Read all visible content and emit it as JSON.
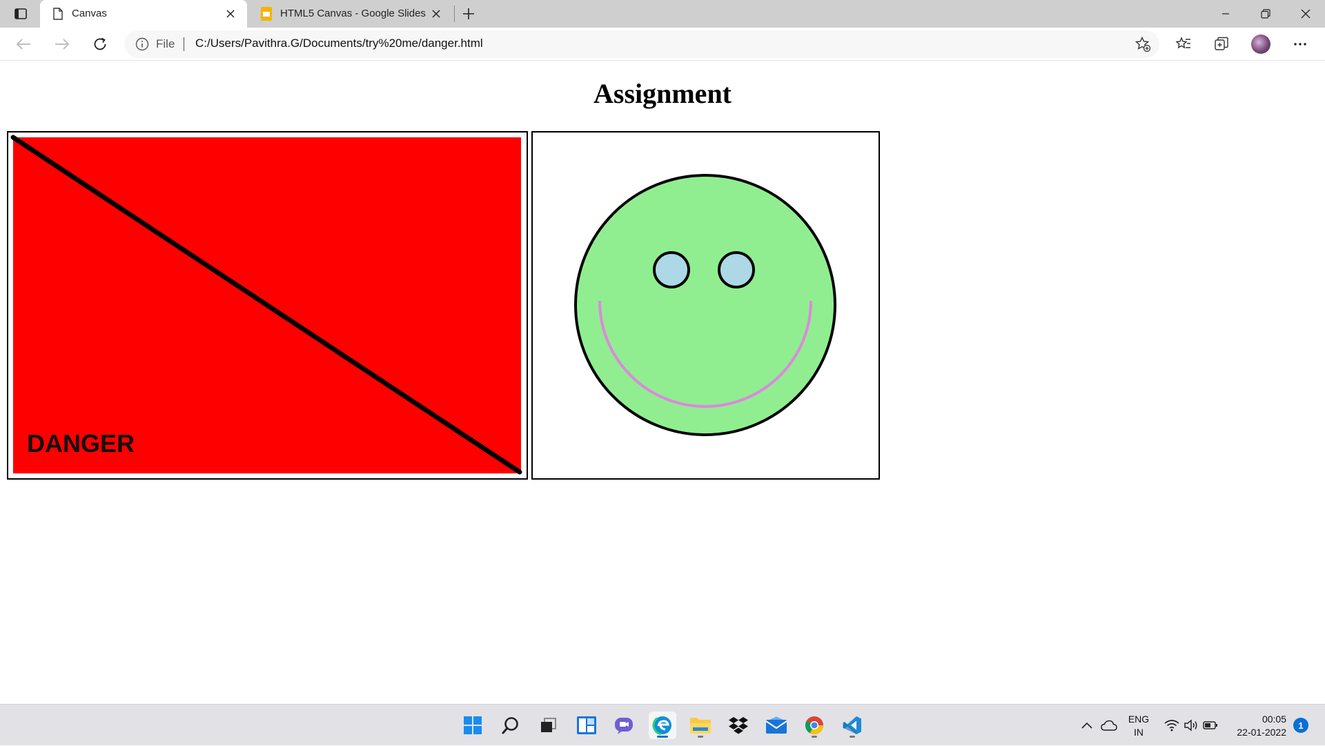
{
  "browser": {
    "tabs": [
      {
        "title": "Canvas",
        "active": true,
        "icon": "page-icon"
      },
      {
        "title": "HTML5 Canvas - Google Slides",
        "active": false,
        "icon": "google-slides-icon"
      }
    ],
    "address": {
      "protocol_label": "File",
      "url": "C:/Users/Pavithra.G/Documents/try%20me/danger.html"
    }
  },
  "page": {
    "title": "Assignment",
    "danger_canvas": {
      "text": "DANGER",
      "fill_color": "#ff0000",
      "line_color": "#000000"
    },
    "smiley_canvas": {
      "face_color": "#90ee90",
      "eye_color": "#add8e6",
      "mouth_color": "#dd88dd",
      "outline_color": "#000000"
    }
  },
  "taskbar": {
    "apps": [
      "start-icon",
      "search-icon",
      "task-view-icon",
      "widgets-icon",
      "teams-chat-icon",
      "edge-icon",
      "file-explorer-icon",
      "dropbox-icon",
      "mail-icon",
      "chrome-icon",
      "vscode-icon"
    ],
    "language": {
      "line1": "ENG",
      "line2": "IN"
    },
    "clock": {
      "time": "00:05",
      "date": "22-01-2022"
    },
    "notifications": "1"
  }
}
